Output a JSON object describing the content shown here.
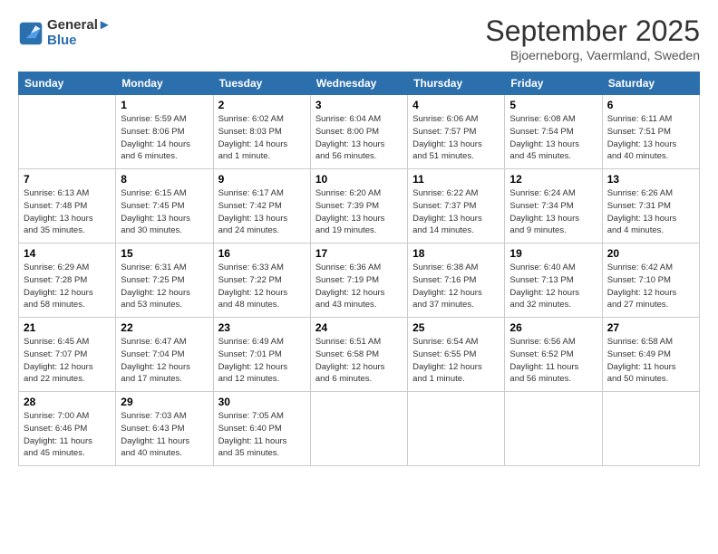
{
  "header": {
    "logo_line1": "General",
    "logo_line2": "Blue",
    "month": "September 2025",
    "location": "Bjoerneborg, Vaermland, Sweden"
  },
  "weekdays": [
    "Sunday",
    "Monday",
    "Tuesday",
    "Wednesday",
    "Thursday",
    "Friday",
    "Saturday"
  ],
  "weeks": [
    [
      {
        "day": "",
        "info": ""
      },
      {
        "day": "1",
        "info": "Sunrise: 5:59 AM\nSunset: 8:06 PM\nDaylight: 14 hours\nand 6 minutes."
      },
      {
        "day": "2",
        "info": "Sunrise: 6:02 AM\nSunset: 8:03 PM\nDaylight: 14 hours\nand 1 minute."
      },
      {
        "day": "3",
        "info": "Sunrise: 6:04 AM\nSunset: 8:00 PM\nDaylight: 13 hours\nand 56 minutes."
      },
      {
        "day": "4",
        "info": "Sunrise: 6:06 AM\nSunset: 7:57 PM\nDaylight: 13 hours\nand 51 minutes."
      },
      {
        "day": "5",
        "info": "Sunrise: 6:08 AM\nSunset: 7:54 PM\nDaylight: 13 hours\nand 45 minutes."
      },
      {
        "day": "6",
        "info": "Sunrise: 6:11 AM\nSunset: 7:51 PM\nDaylight: 13 hours\nand 40 minutes."
      }
    ],
    [
      {
        "day": "7",
        "info": "Sunrise: 6:13 AM\nSunset: 7:48 PM\nDaylight: 13 hours\nand 35 minutes."
      },
      {
        "day": "8",
        "info": "Sunrise: 6:15 AM\nSunset: 7:45 PM\nDaylight: 13 hours\nand 30 minutes."
      },
      {
        "day": "9",
        "info": "Sunrise: 6:17 AM\nSunset: 7:42 PM\nDaylight: 13 hours\nand 24 minutes."
      },
      {
        "day": "10",
        "info": "Sunrise: 6:20 AM\nSunset: 7:39 PM\nDaylight: 13 hours\nand 19 minutes."
      },
      {
        "day": "11",
        "info": "Sunrise: 6:22 AM\nSunset: 7:37 PM\nDaylight: 13 hours\nand 14 minutes."
      },
      {
        "day": "12",
        "info": "Sunrise: 6:24 AM\nSunset: 7:34 PM\nDaylight: 13 hours\nand 9 minutes."
      },
      {
        "day": "13",
        "info": "Sunrise: 6:26 AM\nSunset: 7:31 PM\nDaylight: 13 hours\nand 4 minutes."
      }
    ],
    [
      {
        "day": "14",
        "info": "Sunrise: 6:29 AM\nSunset: 7:28 PM\nDaylight: 12 hours\nand 58 minutes."
      },
      {
        "day": "15",
        "info": "Sunrise: 6:31 AM\nSunset: 7:25 PM\nDaylight: 12 hours\nand 53 minutes."
      },
      {
        "day": "16",
        "info": "Sunrise: 6:33 AM\nSunset: 7:22 PM\nDaylight: 12 hours\nand 48 minutes."
      },
      {
        "day": "17",
        "info": "Sunrise: 6:36 AM\nSunset: 7:19 PM\nDaylight: 12 hours\nand 43 minutes."
      },
      {
        "day": "18",
        "info": "Sunrise: 6:38 AM\nSunset: 7:16 PM\nDaylight: 12 hours\nand 37 minutes."
      },
      {
        "day": "19",
        "info": "Sunrise: 6:40 AM\nSunset: 7:13 PM\nDaylight: 12 hours\nand 32 minutes."
      },
      {
        "day": "20",
        "info": "Sunrise: 6:42 AM\nSunset: 7:10 PM\nDaylight: 12 hours\nand 27 minutes."
      }
    ],
    [
      {
        "day": "21",
        "info": "Sunrise: 6:45 AM\nSunset: 7:07 PM\nDaylight: 12 hours\nand 22 minutes."
      },
      {
        "day": "22",
        "info": "Sunrise: 6:47 AM\nSunset: 7:04 PM\nDaylight: 12 hours\nand 17 minutes."
      },
      {
        "day": "23",
        "info": "Sunrise: 6:49 AM\nSunset: 7:01 PM\nDaylight: 12 hours\nand 12 minutes."
      },
      {
        "day": "24",
        "info": "Sunrise: 6:51 AM\nSunset: 6:58 PM\nDaylight: 12 hours\nand 6 minutes."
      },
      {
        "day": "25",
        "info": "Sunrise: 6:54 AM\nSunset: 6:55 PM\nDaylight: 12 hours\nand 1 minute."
      },
      {
        "day": "26",
        "info": "Sunrise: 6:56 AM\nSunset: 6:52 PM\nDaylight: 11 hours\nand 56 minutes."
      },
      {
        "day": "27",
        "info": "Sunrise: 6:58 AM\nSunset: 6:49 PM\nDaylight: 11 hours\nand 50 minutes."
      }
    ],
    [
      {
        "day": "28",
        "info": "Sunrise: 7:00 AM\nSunset: 6:46 PM\nDaylight: 11 hours\nand 45 minutes."
      },
      {
        "day": "29",
        "info": "Sunrise: 7:03 AM\nSunset: 6:43 PM\nDaylight: 11 hours\nand 40 minutes."
      },
      {
        "day": "30",
        "info": "Sunrise: 7:05 AM\nSunset: 6:40 PM\nDaylight: 11 hours\nand 35 minutes."
      },
      {
        "day": "",
        "info": ""
      },
      {
        "day": "",
        "info": ""
      },
      {
        "day": "",
        "info": ""
      },
      {
        "day": "",
        "info": ""
      }
    ]
  ]
}
